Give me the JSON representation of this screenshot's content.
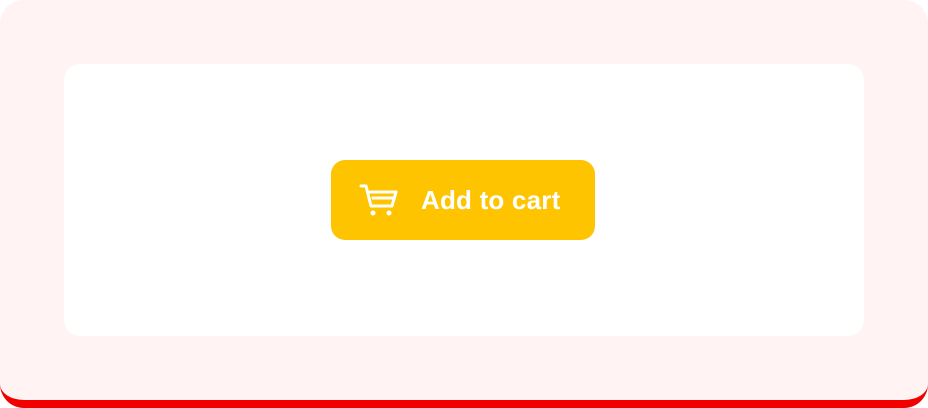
{
  "colors": {
    "page_background": "#fff3f3",
    "bottom_border": "#f20000",
    "card_background": "#ffffff",
    "button_background": "#ffc400",
    "button_text": "#ffffff"
  },
  "button": {
    "label": "Add to cart",
    "icon": "shopping-cart-icon"
  }
}
